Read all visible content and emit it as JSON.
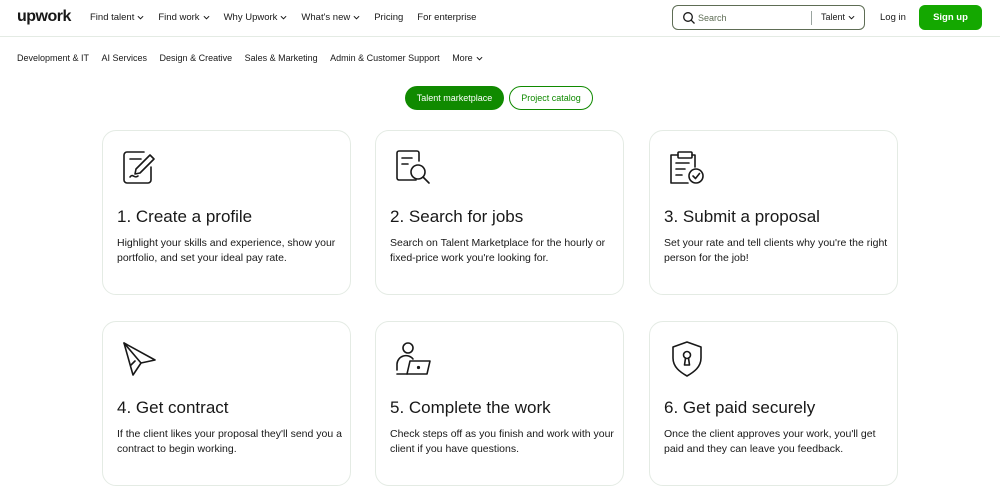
{
  "header": {
    "logo": "upwork",
    "nav": [
      {
        "label": "Find talent",
        "dropdown": true
      },
      {
        "label": "Find work",
        "dropdown": true
      },
      {
        "label": "Why Upwork",
        "dropdown": true
      },
      {
        "label": "What's new",
        "dropdown": true
      },
      {
        "label": "Pricing",
        "dropdown": false
      },
      {
        "label": "For enterprise",
        "dropdown": false
      }
    ],
    "search": {
      "placeholder": "Search",
      "scope": "Talent"
    },
    "login_label": "Log in",
    "signup_label": "Sign up"
  },
  "categories": [
    "Development & IT",
    "AI Services",
    "Design & Creative",
    "Sales & Marketing",
    "Admin & Customer Support",
    "More"
  ],
  "toggle": {
    "active": "Talent marketplace",
    "inactive": "Project catalog"
  },
  "steps": [
    {
      "title": "1. Create a profile",
      "desc": "Highlight your skills and experience, show your portfolio, and set your ideal pay rate.",
      "icon": "edit-profile-icon"
    },
    {
      "title": "2. Search for jobs",
      "desc": "Search on Talent Marketplace for the hourly or fixed-price work you're looking for.",
      "icon": "search-jobs-icon"
    },
    {
      "title": "3. Submit a proposal",
      "desc": "Set your rate and tell clients why you're the right person for the job!",
      "icon": "clipboard-check-icon"
    },
    {
      "title": "4. Get contract",
      "desc": "If the client likes your proposal they'll send you a contract to begin working.",
      "icon": "paper-plane-icon"
    },
    {
      "title": "5. Complete the work",
      "desc": "Check steps off as you finish and work with your client if you have questions.",
      "icon": "person-laptop-icon"
    },
    {
      "title": "6. Get paid securely",
      "desc": "Once the client approves your work, you'll get paid and they can leave you feedback.",
      "icon": "shield-lock-icon"
    }
  ],
  "colors": {
    "brand_green": "#14a800",
    "toggle_green": "#108a00",
    "text": "#181818"
  }
}
